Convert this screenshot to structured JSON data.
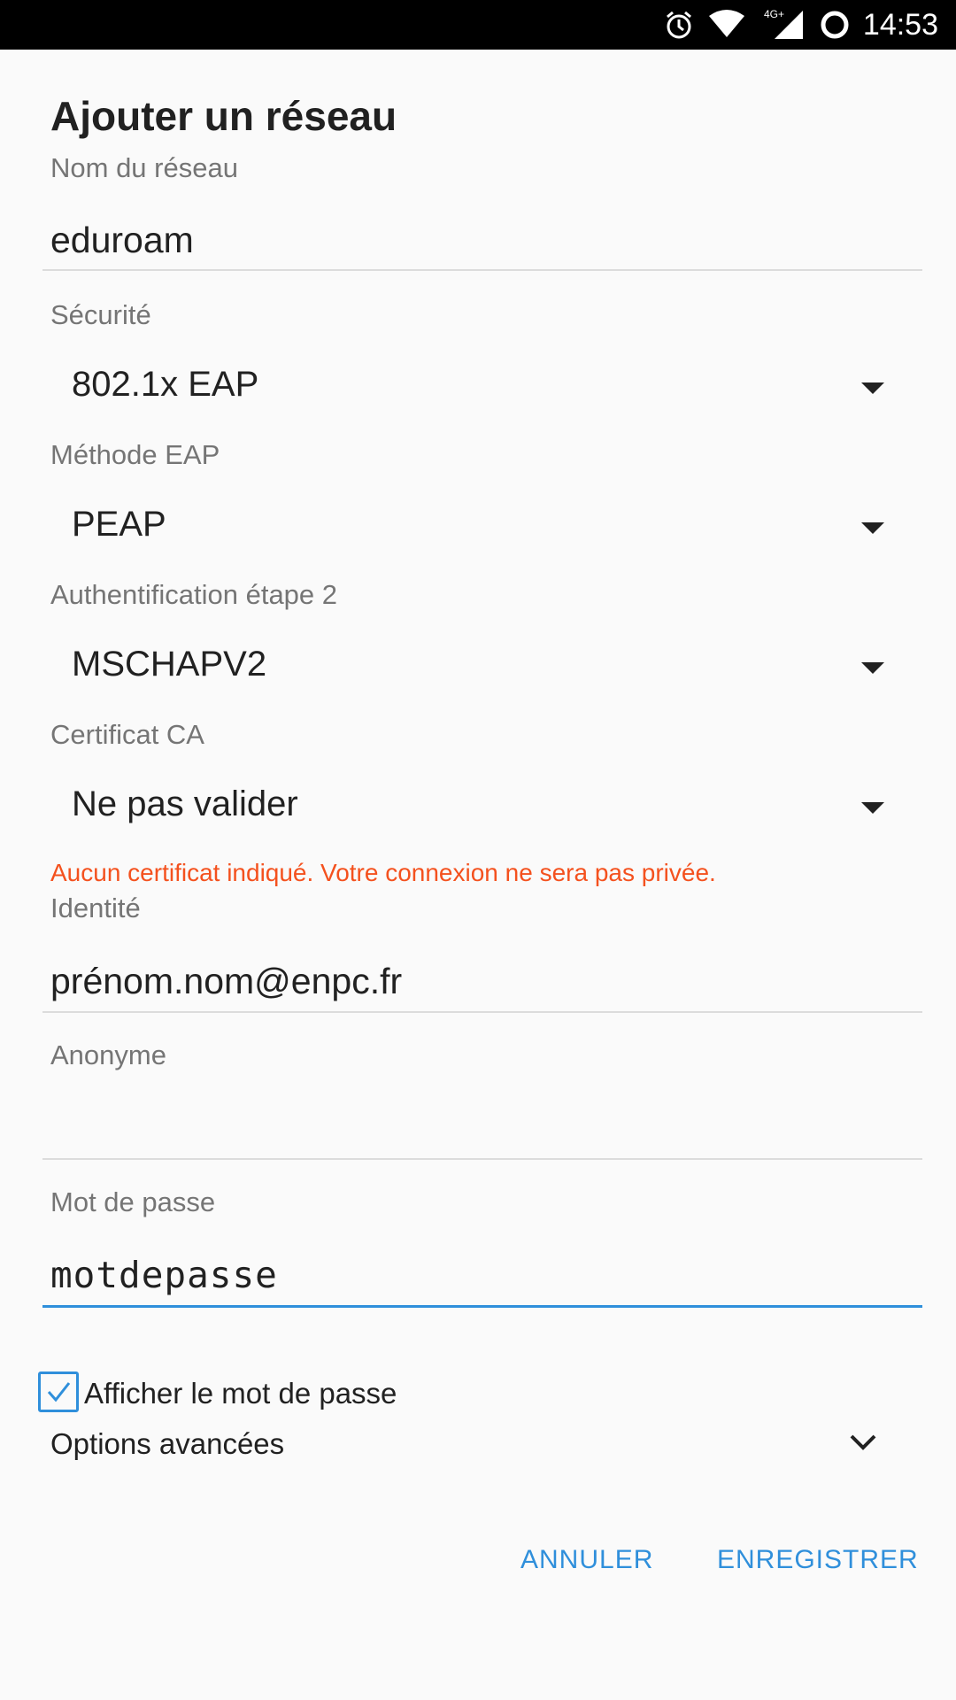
{
  "status_bar": {
    "time": "14:53",
    "network": "4G+",
    "icons": [
      "alarm-icon",
      "wifi-icon",
      "cellular-signal-icon",
      "circle-icon"
    ]
  },
  "dialog": {
    "title": "Ajouter un réseau",
    "fields": {
      "network_name": {
        "label": "Nom du réseau",
        "value": "eduroam"
      },
      "security": {
        "label": "Sécurité",
        "value": "802.1x EAP"
      },
      "eap_method": {
        "label": "Méthode EAP",
        "value": "PEAP"
      },
      "phase2_auth": {
        "label": "Authentification étape 2",
        "value": "MSCHAPV2"
      },
      "ca_certificate": {
        "label": "Certificat CA",
        "value": "Ne pas valider",
        "warning": "Aucun certificat indiqué. Votre connexion ne sera pas privée."
      },
      "identity": {
        "label": "Identité",
        "value": "prénom.nom@enpc.fr"
      },
      "anonymous": {
        "label": "Anonyme",
        "value": ""
      },
      "password": {
        "label": "Mot de passe",
        "value": "motdepasse"
      }
    },
    "show_password": {
      "label": "Afficher le mot de passe",
      "checked": true
    },
    "advanced_options": {
      "label": "Options avancées"
    },
    "buttons": {
      "cancel": "ANNULER",
      "save": "ENREGISTRER"
    }
  },
  "colors": {
    "accent": "#2f8fdb",
    "warning": "#f4511e",
    "label": "#757575"
  }
}
